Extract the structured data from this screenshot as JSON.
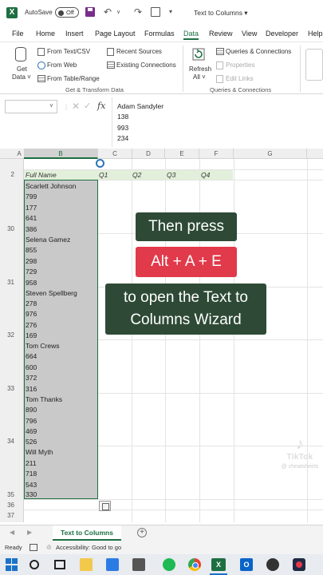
{
  "titlebar": {
    "app_icon": "X",
    "autosave_label": "AutoSave",
    "autosave_state": "Off",
    "doc_title": "Text to Columns ▾",
    "more_label": "▾"
  },
  "menu": {
    "tabs": [
      "File",
      "Home",
      "Insert",
      "Page Layout",
      "Formulas",
      "Data",
      "Review",
      "View",
      "Developer",
      "Help"
    ],
    "active": "Data"
  },
  "ribbon": {
    "get_data": "Get",
    "get_data_line2": "Data ˅",
    "from_text_csv": "From Text/CSV",
    "from_web": "From Web",
    "from_table_range": "From Table/Range",
    "recent_sources": "Recent Sources",
    "existing_connections": "Existing Connections",
    "group_get_transform": "Get & Transform Data",
    "refresh_label": "Refresh",
    "refresh_all": "All ˅",
    "queries_connections": "Queries & Connections",
    "properties": "Properties",
    "edit_links": "Edit Links",
    "group_queries": "Queries & Connections"
  },
  "formula_bar": {
    "fx": "fx",
    "lines": [
      "Adam Sandyler",
      "138",
      "993",
      "234"
    ]
  },
  "sheet": {
    "columns": [
      "A",
      "B",
      "C",
      "D",
      "E",
      "F",
      "G"
    ],
    "header_row": {
      "row_number": "2",
      "full_name": "Full Name",
      "q1": "Q1",
      "q2": "Q2",
      "q3": "Q3",
      "q4": "Q4"
    },
    "row_numbers": [
      "30",
      "31",
      "32",
      "33",
      "34",
      "35",
      "36",
      "37"
    ],
    "cells": [
      "Scarlett Johnson",
      "799",
      "177",
      "641",
      "386",
      "Selena Gamez",
      "855",
      "298",
      "729",
      "958",
      "Steven Spellberg",
      "278",
      "976",
      "276",
      "169",
      "Tom Crews",
      "664",
      "600",
      "372",
      "316",
      "Tom Thanks",
      "890",
      "796",
      "469",
      "526",
      "Will Myth",
      "211",
      "718",
      "543",
      "330"
    ]
  },
  "overlay": {
    "line1": "Then press",
    "keys": "Alt + A + E",
    "line3a": "to open the Text to",
    "line3b": "Columns Wizard"
  },
  "watermark": {
    "name": "TikTok",
    "handle": "@ cheatsheets"
  },
  "tabs": {
    "nav_prev": "◀",
    "nav_next": "▶",
    "sheet_name": "Text to Columns",
    "add_sheet": "+"
  },
  "status": {
    "ready": "Ready",
    "accessibility": "Accessibility: Good to go"
  }
}
